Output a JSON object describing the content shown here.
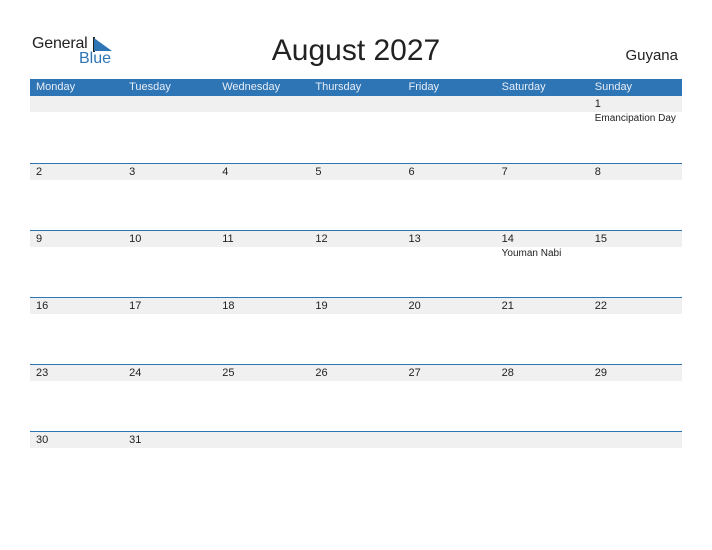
{
  "logo": {
    "word1": "General",
    "word2": "Blue"
  },
  "title": "August 2027",
  "country": "Guyana",
  "colors": {
    "accent": "#2e75b6",
    "strip": "#f0f0f0"
  },
  "weekdays": [
    "Monday",
    "Tuesday",
    "Wednesday",
    "Thursday",
    "Friday",
    "Saturday",
    "Sunday"
  ],
  "weeks": [
    [
      {
        "d": ""
      },
      {
        "d": ""
      },
      {
        "d": ""
      },
      {
        "d": ""
      },
      {
        "d": ""
      },
      {
        "d": ""
      },
      {
        "d": "1",
        "h": "Emancipation Day"
      }
    ],
    [
      {
        "d": "2"
      },
      {
        "d": "3"
      },
      {
        "d": "4"
      },
      {
        "d": "5"
      },
      {
        "d": "6"
      },
      {
        "d": "7"
      },
      {
        "d": "8"
      }
    ],
    [
      {
        "d": "9"
      },
      {
        "d": "10"
      },
      {
        "d": "11"
      },
      {
        "d": "12"
      },
      {
        "d": "13"
      },
      {
        "d": "14",
        "h": "Youman Nabi"
      },
      {
        "d": "15"
      }
    ],
    [
      {
        "d": "16"
      },
      {
        "d": "17"
      },
      {
        "d": "18"
      },
      {
        "d": "19"
      },
      {
        "d": "20"
      },
      {
        "d": "21"
      },
      {
        "d": "22"
      }
    ],
    [
      {
        "d": "23"
      },
      {
        "d": "24"
      },
      {
        "d": "25"
      },
      {
        "d": "26"
      },
      {
        "d": "27"
      },
      {
        "d": "28"
      },
      {
        "d": "29"
      }
    ],
    [
      {
        "d": "30"
      },
      {
        "d": "31"
      },
      {
        "d": ""
      },
      {
        "d": ""
      },
      {
        "d": ""
      },
      {
        "d": ""
      },
      {
        "d": ""
      }
    ]
  ]
}
